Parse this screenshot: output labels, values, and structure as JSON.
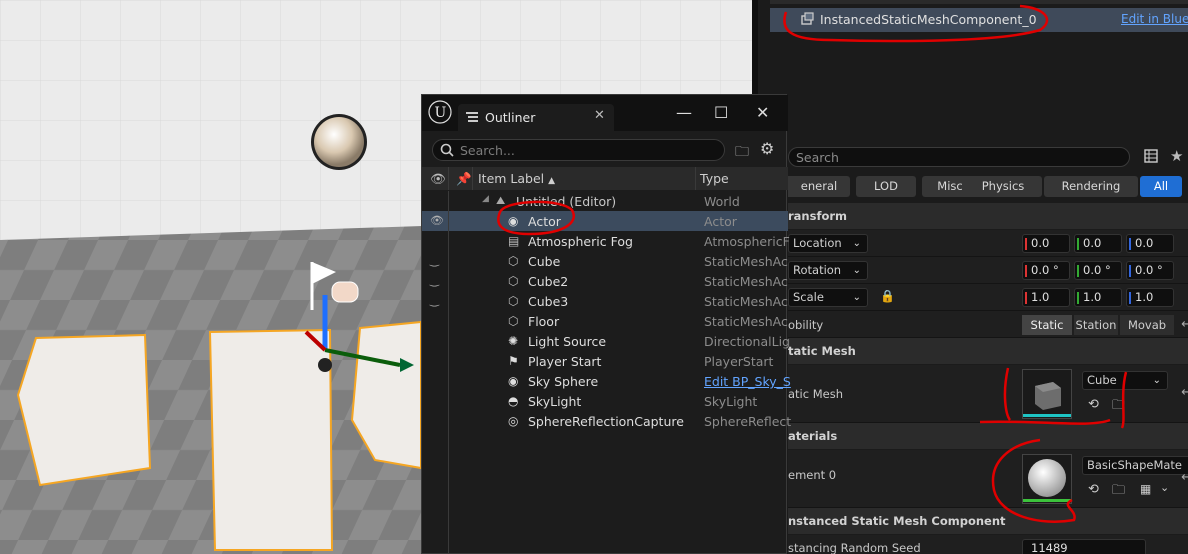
{
  "component": {
    "name": "InstancedStaticMeshComponent_0",
    "edit_link": "Edit in Blueprint"
  },
  "details": {
    "search_placeholder": "Search",
    "filters": [
      "eneral",
      "LOD",
      "Misc",
      "Physics",
      "Rendering",
      "All"
    ],
    "sections": {
      "transform": "ransform",
      "static_mesh": "tatic Mesh",
      "materials": "aterials",
      "ism": "nstanced Static Mesh Component"
    },
    "location": {
      "label": "Location",
      "x": "0.0",
      "y": "0.0",
      "z": "0.0"
    },
    "rotation": {
      "label": "Rotation",
      "x": "0.0 °",
      "y": "0.0 °",
      "z": "0.0 °"
    },
    "scale": {
      "label": "Scale",
      "x": "1.0",
      "y": "1.0",
      "z": "1.0"
    },
    "mobility": {
      "label": "obility",
      "options": [
        "Static",
        "Station",
        "Movab"
      ],
      "selected": "Static"
    },
    "static_mesh": {
      "label": "atic Mesh",
      "value": "Cube"
    },
    "element0": {
      "label": "ement 0",
      "value": "BasicShapeMate"
    },
    "random_seed": {
      "label": "stancing Random Seed",
      "value": "11489"
    }
  },
  "outliner": {
    "tab_title": "Outliner",
    "search_placeholder": "Search...",
    "col_label": "Item Label",
    "col_type": "Type",
    "rows": [
      {
        "name": "Untitled (Editor)",
        "type": "World"
      },
      {
        "name": "Actor",
        "type": "Actor"
      },
      {
        "name": "Atmospheric Fog",
        "type": "AtmosphericF"
      },
      {
        "name": "Cube",
        "type": "StaticMeshAc"
      },
      {
        "name": "Cube2",
        "type": "StaticMeshAc"
      },
      {
        "name": "Cube3",
        "type": "StaticMeshAc"
      },
      {
        "name": "Floor",
        "type": "StaticMeshAc"
      },
      {
        "name": "Light Source",
        "type": "DirectionalLig"
      },
      {
        "name": "Player Start",
        "type": "PlayerStart"
      },
      {
        "name": "Sky Sphere",
        "type": "Edit BP_Sky_S"
      },
      {
        "name": "SkyLight",
        "type": "SkyLight"
      },
      {
        "name": "SphereReflectionCapture",
        "type": "SphereReflect"
      }
    ]
  },
  "colors": {
    "accent": "#1f6ed4",
    "selection": "#3c4b5e",
    "annotation": "#e00000",
    "link": "#62a4ff"
  }
}
